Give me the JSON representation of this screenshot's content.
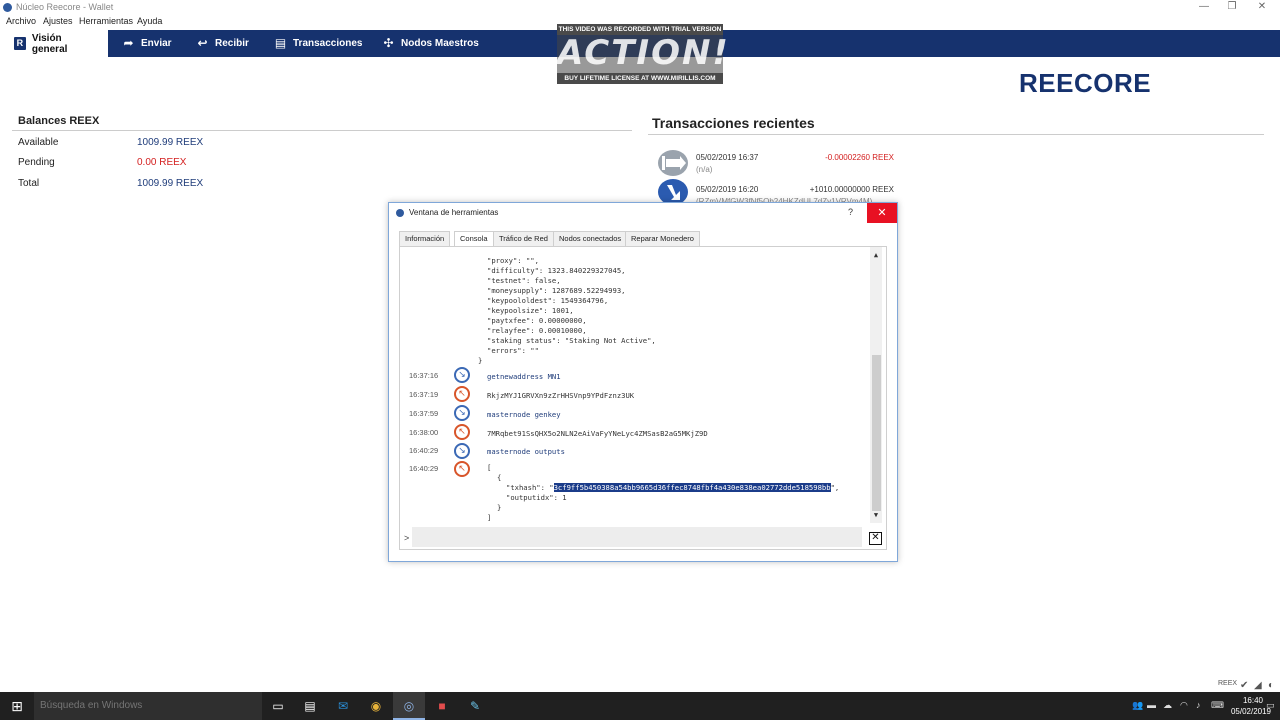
{
  "window": {
    "title": "Núcleo Reecore - Wallet",
    "minimize": "—",
    "maximize": "❐",
    "close": "✕"
  },
  "menu": [
    "Archivo",
    "Ajustes",
    "Herramientas",
    "Ayuda"
  ],
  "toolbar": {
    "items": [
      {
        "label": "Visión general",
        "icon": "R"
      },
      {
        "label": "Enviar",
        "icon": "➦"
      },
      {
        "label": "Recibir",
        "icon": "↩"
      },
      {
        "label": "Transacciones",
        "icon": "▤"
      },
      {
        "label": "Nodos Maestros",
        "icon": "✣"
      }
    ]
  },
  "watermark": {
    "top": "THIS VIDEO WAS RECORDED WITH TRIAL VERSION",
    "logo": "ACTION!",
    "bottom": "BUY LIFETIME LICENSE AT WWW.MIRILLIS.COM"
  },
  "brand": "REECORE",
  "balances": {
    "title": "Balances REEX",
    "rows": [
      {
        "label": "Available",
        "value": "1009.99 REEX"
      },
      {
        "label": "Pending",
        "value": "0.00 REEX"
      },
      {
        "label": "Total",
        "value": "1009.99 REEX"
      }
    ]
  },
  "recent": {
    "title": "Transacciones recientes",
    "items": [
      {
        "date": "05/02/2019 16:37",
        "sub": "(n/a)",
        "amount": "-0.00002260 REEX",
        "color": "#d42020"
      },
      {
        "date": "05/02/2019 16:20",
        "sub": "(RZmVMfGW3fNf5Qb24HKZdUL7dZy1VRVm4M)",
        "amount": "+1010.00000000 REEX",
        "color": "#333333"
      }
    ]
  },
  "dialog": {
    "title": "Ventana de herramientas",
    "help": "?",
    "close": "✕",
    "tabs": [
      "Información",
      "Consola",
      "Tráfico de Red",
      "Nodos conectados",
      "Reparar Monedero"
    ],
    "json_lines": [
      "\"proxy\": \"\",",
      "\"difficulty\": 1323.840229327045,",
      "\"testnet\": false,",
      "\"moneysupply\": 1287689.52294993,",
      "\"keypoololdest\": 1549364796,",
      "\"keypoolsize\": 1001,",
      "\"paytxfee\": 0.00000000,",
      "\"relayfee\": 0.00010000,",
      "\"staking status\": \"Staking Not Active\",",
      "\"errors\": \"\"",
      "}"
    ],
    "entries": [
      {
        "time": "16:37:16",
        "kind": "in",
        "text": "getnewaddress MN1"
      },
      {
        "time": "16:37:19",
        "kind": "out",
        "text": "RkjzMYJ1GRVXn9zZrHHSVnp9YPdFznz3UK"
      },
      {
        "time": "16:37:59",
        "kind": "in",
        "text": "masternode genkey"
      },
      {
        "time": "16:38:00",
        "kind": "out",
        "text": "7MRqbet91SsQHX5o2NLN2eAiVaFyYNeLyc4ZMSasB2aG5MKjZ9D"
      },
      {
        "time": "16:40:29",
        "kind": "in",
        "text": "masternode outputs"
      },
      {
        "time": "16:40:29",
        "kind": "out",
        "text": "["
      }
    ],
    "output_lines": {
      "open_brace": "{",
      "txhash_key": "\"txhash\": \"",
      "txhash_value": "3cf9ff5b450388a54bb9665d36ffec8748fbf4a430e838ea02772dde518598bb",
      "txhash_end": "\",",
      "outputidx": "\"outputidx\": 1",
      "close_brace": "}",
      "close_bracket": "]"
    },
    "prompt": ">",
    "input_value": "",
    "clear_icon": "✕"
  },
  "status_tray": {
    "label": "REEX"
  },
  "taskbar": {
    "search_placeholder": "Búsqueda en Windows",
    "clock_time": "16:40",
    "clock_date": "05/02/2019"
  }
}
